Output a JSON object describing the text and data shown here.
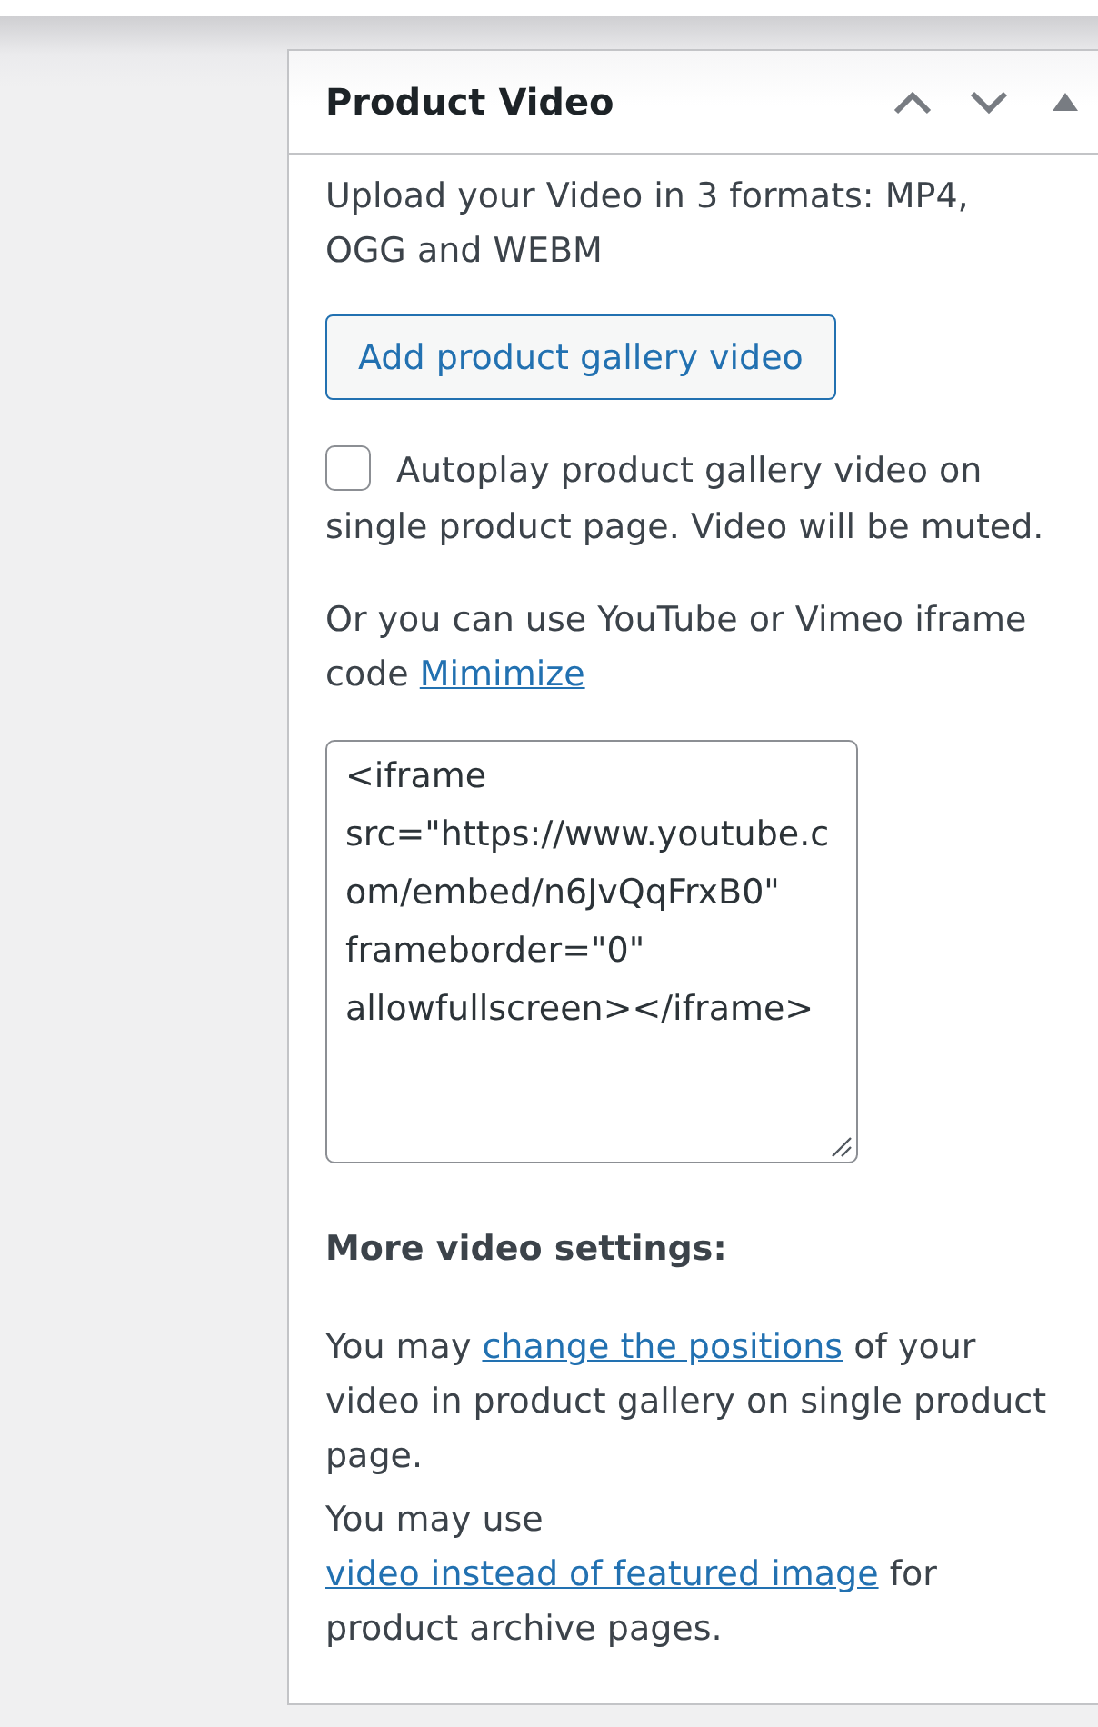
{
  "panel": {
    "title": "Product Video"
  },
  "description": "Upload your Video in 3 formats: MP4, OGG and WEBM",
  "add_video_button": {
    "label": "Add product gallery video"
  },
  "autoplay": {
    "label": "Autoplay product gallery video on single product page. Video will be muted.",
    "checked": false
  },
  "iframe_hint": {
    "text": "Or you can use YouTube or Vimeo iframe code",
    "link": "Mimimize"
  },
  "embed_code": {
    "value": "<iframe src=\"https://www.youtube.com/embed/n6JvQqFrxB0\" frameborder=\"0\" allowfullscreen></iframe>"
  },
  "more_settings": {
    "heading": "More video settings:",
    "paragraphs": [
      {
        "before": "You may",
        "link": "change the positions",
        "after": "of your video in product gallery on single product page."
      },
      {
        "before": "You may use",
        "link": "video instead of featured image",
        "after": "for product archive pages."
      }
    ]
  }
}
